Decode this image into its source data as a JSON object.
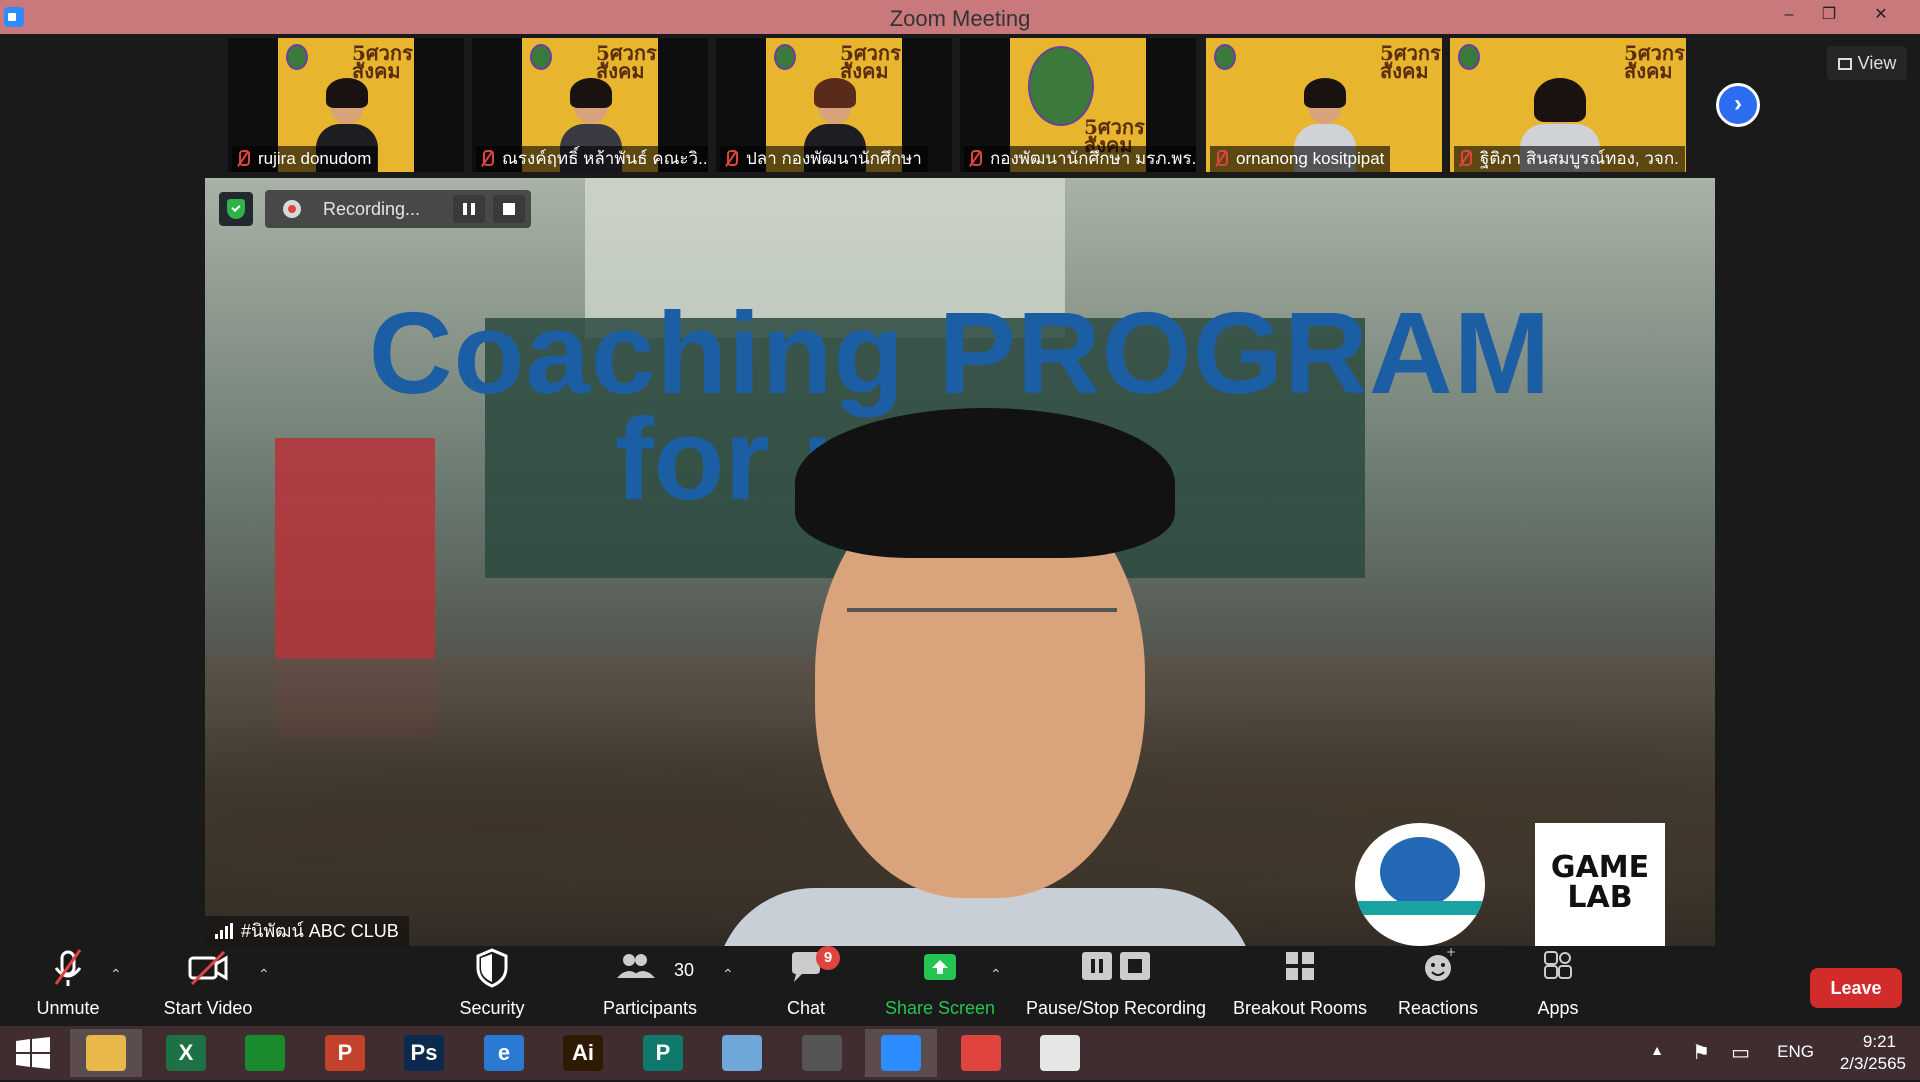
{
  "window": {
    "title": "Zoom Meeting",
    "controls": {
      "minimize": "–",
      "restore": "❐",
      "close": "✕"
    }
  },
  "gallery": {
    "tiles": [
      {
        "name": "rujira donudom"
      },
      {
        "name": "ณรงค์ฤทธิ์ หล้าพันธ์ คณะวิ..."
      },
      {
        "name": "ปลา กองพัฒนานักศึกษา"
      },
      {
        "name": "กองพัฒนานักศึกษา มรภ.พร..."
      },
      {
        "name": "ornanong kositpipat"
      },
      {
        "name": "ฐิติภา สินสมบูรณ์ทอง, วจก."
      }
    ],
    "brand_text": [
      "5ศวกร",
      "สังคม"
    ],
    "next_page": "›",
    "view_label": "View"
  },
  "main_video": {
    "headline_line1": "Coaching PROGRAM",
    "headline_line2": "for     rer",
    "logo_text": "GAME LAB"
  },
  "recording": {
    "label": "Recording..."
  },
  "speaker": {
    "name": "#นิพัฒน์ ABC CLUB"
  },
  "toolbar": {
    "unmute": "Unmute",
    "start_video": "Start Video",
    "security": "Security",
    "participants": "Participants",
    "participants_count": "30",
    "chat": "Chat",
    "chat_badge": "9",
    "share_screen": "Share Screen",
    "pause_stop_recording": "Pause/Stop Recording",
    "breakout_rooms": "Breakout Rooms",
    "reactions": "Reactions",
    "apps": "Apps",
    "leave": "Leave"
  },
  "taskbar": {
    "apps": [
      {
        "name": "file-explorer",
        "glyph": "",
        "color": "#e8b84a"
      },
      {
        "name": "excel",
        "glyph": "X",
        "color": "#1e7145"
      },
      {
        "name": "store",
        "glyph": "",
        "color": "#1a8a2e"
      },
      {
        "name": "powerpoint",
        "glyph": "P",
        "color": "#c4412a"
      },
      {
        "name": "photoshop",
        "glyph": "Ps",
        "color": "#0b2a4d"
      },
      {
        "name": "internet-explorer",
        "glyph": "e",
        "color": "#2a7ad4"
      },
      {
        "name": "illustrator",
        "glyph": "Ai",
        "color": "#2f1a04"
      },
      {
        "name": "publisher",
        "glyph": "P",
        "color": "#0f7a6c"
      },
      {
        "name": "app-blue",
        "glyph": "",
        "color": "#6fa8d8"
      },
      {
        "name": "photoscape",
        "glyph": "",
        "color": "#555555"
      },
      {
        "name": "zoom",
        "glyph": "",
        "color": "#2d8cff"
      },
      {
        "name": "chrome",
        "glyph": "",
        "color": "#e0443e"
      },
      {
        "name": "app-photos",
        "glyph": "",
        "color": "#e6e6e6"
      }
    ],
    "tray": {
      "language": "ENG",
      "time": "9:21",
      "date": "2/3/2565"
    }
  },
  "colors": {
    "titlebar": "#c9797c",
    "accent_blue": "#2b6cf0",
    "leave_red": "#d22b2b",
    "share_green": "#23c552"
  }
}
